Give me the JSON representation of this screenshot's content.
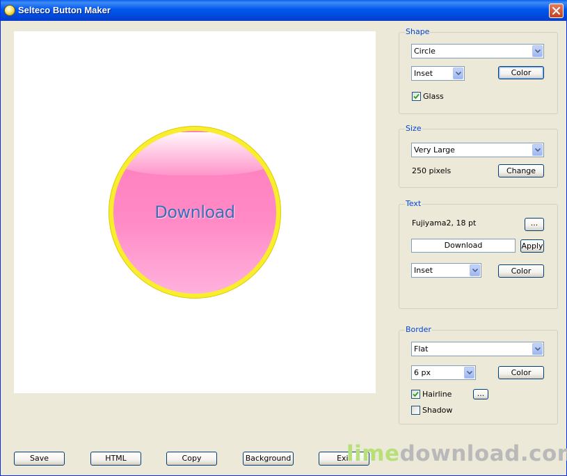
{
  "window": {
    "title": "Selteco Button Maker"
  },
  "preview": {
    "label": "Download"
  },
  "shape": {
    "legend": "Shape",
    "shape_value": "Circle",
    "style_value": "Inset",
    "color_label": "Color",
    "glass_label": "Glass",
    "glass_checked": true
  },
  "size": {
    "legend": "Size",
    "size_value": "Very Large",
    "pixels_text": "250 pixels",
    "change_label": "Change"
  },
  "text": {
    "legend": "Text",
    "font_text": "Fujiyama2, 18 pt",
    "font_button_label": "...",
    "text_value": "Download",
    "apply_label": "Apply",
    "style_value": "Inset",
    "color_label": "Color"
  },
  "border": {
    "legend": "Border",
    "style_value": "Flat",
    "width_value": "6 px",
    "color_label": "Color",
    "hairline_label": "Hairline",
    "hairline_checked": true,
    "hairline_button_label": "...",
    "shadow_label": "Shadow",
    "shadow_checked": false
  },
  "buttons": {
    "save": "Save",
    "html": "HTML",
    "copy": "Copy",
    "background": "Background",
    "exit": "Exit"
  },
  "watermark": {
    "part1": "lime",
    "part2": "download.com"
  },
  "colors": {
    "title_bar": "#0058EE",
    "button_fill": "#FF8AC5",
    "button_border": "#F9EE2E",
    "button_text": "#3D6FB8",
    "legend_text": "#0046D5"
  },
  "icons": {
    "close": "close-icon",
    "app": "app-icon",
    "dropdown": "chevron-down-icon",
    "check": "checkmark-icon"
  }
}
